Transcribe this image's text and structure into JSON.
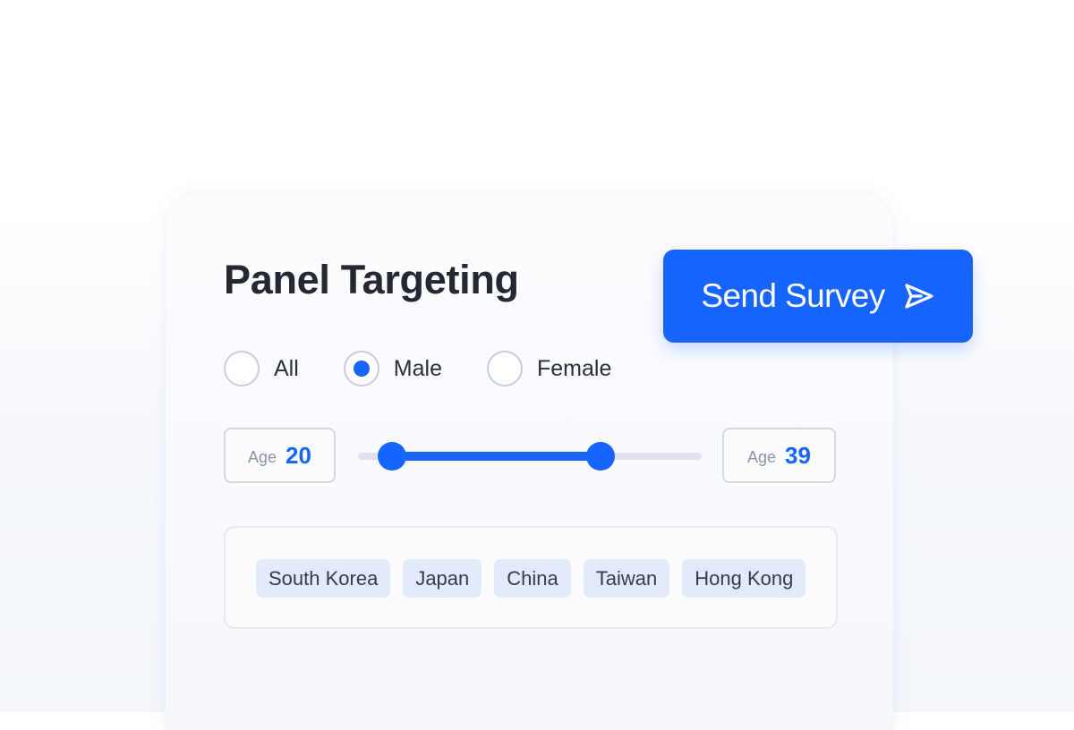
{
  "panel": {
    "title": "Panel Targeting"
  },
  "send_button": {
    "label": "Send Survey",
    "icon": "send-icon"
  },
  "gender": {
    "options": [
      {
        "label": "All",
        "selected": false
      },
      {
        "label": "Male",
        "selected": true
      },
      {
        "label": "Female",
        "selected": false
      }
    ]
  },
  "age": {
    "prefix": "Age",
    "min_value": "20",
    "max_value": "39"
  },
  "regions": {
    "chips": [
      "South Korea",
      "Japan",
      "China",
      "Taiwan",
      "Hong Kong"
    ]
  },
  "colors": {
    "accent": "#1764ff",
    "title_text": "#232833",
    "chip_background": "#e3ebfb",
    "radio_border": "#c9cfda"
  }
}
